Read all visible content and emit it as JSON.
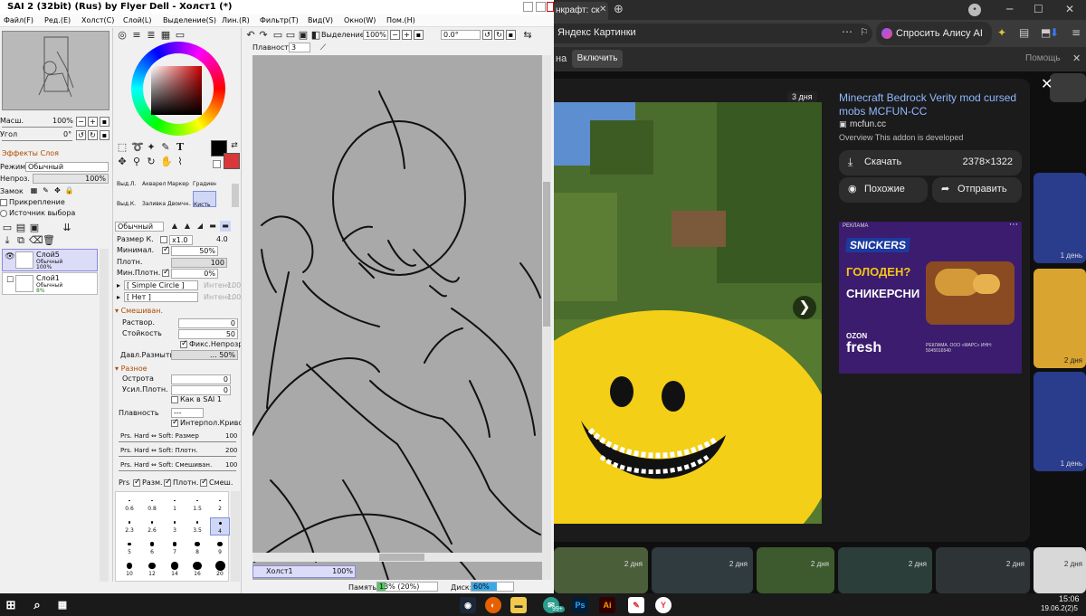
{
  "sai": {
    "title": "SAI 2 (32bit) (Rus) by Flyer Dell - Холст1 (*)",
    "menu": [
      "Файл(F)",
      "Ред.(E)",
      "Холст(C)",
      "Слой(L)",
      "Выделение(S)",
      "Лин.(R)",
      "Фильтр(T)",
      "Вид(V)",
      "Окно(W)",
      "Пом.(H)"
    ],
    "navigator": {
      "zoom_label": "Масш.",
      "zoom_value": "100%",
      "angle_label": "Угол",
      "angle_value": "0°"
    },
    "layer_props": {
      "effects_label": "Эффекты Слоя",
      "mode_label": "Режим",
      "mode_value": "Обычный",
      "opacity_label": "Непроз.",
      "opacity_value": "100%",
      "lock_label": "Замок",
      "clipping_label": "Прикрепление",
      "selection_source_label": "Источник выбора"
    },
    "layers": [
      {
        "name": "Слой5",
        "mode": "Обычный",
        "opacity": "100%",
        "selected": true
      },
      {
        "name": "Слой1",
        "mode": "Обычный",
        "opacity": "8%",
        "selected": false
      }
    ],
    "brush_tools": [
      {
        "label": "Выд.Л.",
        "active": false
      },
      {
        "label": "Акварель",
        "active": false
      },
      {
        "label": "Маркер",
        "active": false
      },
      {
        "label": "Градиент",
        "active": false
      },
      {
        "label": "Выд.К.",
        "active": false
      },
      {
        "label": "Заливка",
        "active": false
      },
      {
        "label": "Двоичн..",
        "active": false
      },
      {
        "label": "Кисть",
        "active": true
      }
    ],
    "brush": {
      "blend_mode": "Обычный",
      "size_label": "Размер К.",
      "size_mult": "x1.0",
      "size_value": "4.0",
      "min_label": "Минимал.",
      "min_value": "50%",
      "density_label": "Плотн.",
      "density_value": "100",
      "min_density_label": "Мин.Плотн.",
      "min_density_value": "0%",
      "shape_value": "[ Simple Circle ]",
      "shape_strength": "Интенс.",
      "shape_strength_value": "100",
      "texture_value": "[ Нет ]",
      "texture_strength": "Интенс.",
      "texture_strength_value": "100",
      "mix_section": "Смешиван.",
      "dilution_label": "Раствор.",
      "dilution_value": "0",
      "persistence_label": "Стойкость",
      "persistence_value": "50",
      "keep_opacity_label": "Фикс.Непрозр.",
      "blur_pressure_label": "Давл.Размытия",
      "blur_pressure_value": "... 50%",
      "misc_section": "Разное",
      "sharpness_label": "Острота",
      "sharpness_value": "0",
      "density_boost_label": "Усил.Плотн.",
      "density_boost_value": "0",
      "like_sai1_label": "Как в SAI 1",
      "smooth_label": "Плавность",
      "smooth_value": "---",
      "interp_curve_label": "Интерпол.Кривой",
      "prs_size_label": "Prs. Hard ⇔ Soft: Размер",
      "prs_size_value": "100",
      "prs_density_label": "Prs. Hard ⇔ Soft: Плотн.",
      "prs_density_value": "200",
      "prs_mix_label": "Prs. Hard ⇔ Soft: Смешиван.",
      "prs_mix_value": "100",
      "prs_label": "Prs",
      "prs_size_check": "Разм.",
      "prs_density_check": "Плотн.",
      "prs_mix_check": "Смеш."
    },
    "brush_sizes": [
      [
        "0.6",
        "0.8",
        "1",
        "1.5",
        "2"
      ],
      [
        "2.3",
        "2.6",
        "3",
        "3.5",
        "4"
      ],
      [
        "5",
        "6",
        "7",
        "8",
        "9"
      ],
      [
        "10",
        "12",
        "14",
        "16",
        "20"
      ]
    ],
    "canvas_toolbar": {
      "selection_label": "Выделение",
      "zoom_value": "100%",
      "angle_value": "0.0°",
      "smooth_label": "Плавность",
      "smooth_value": "3"
    },
    "canvas_tab": {
      "name": "Холст1",
      "zoom": "100%"
    },
    "status": {
      "memory_label": "Память:",
      "memory_value": "13% (20%)",
      "memory_fill": 0.13,
      "disk_label": "Диск:",
      "disk_value": "60%",
      "disk_fill": 0.6
    }
  },
  "browser": {
    "tab_title": "нкрафт: ск",
    "address_title": "Яндекс Картинки",
    "ask_alice": "Спросить Алису AI",
    "notif_text": "на",
    "notif_button": "Включить",
    "help": "Помощь",
    "preview": {
      "age_badge": "3 дня",
      "title": "Minecraft Bedrock Verity mod cursed mobs MCFUN-CC",
      "source": "mcfun.cc",
      "desc": "Overview This addon is developed",
      "download_label": "Скачать",
      "resolution": "2378×1322",
      "similar_label": "Похожие",
      "share_label": "Отправить"
    },
    "ad": {
      "tag": "РЕКЛАМА",
      "brand": "SNICKERS",
      "headline_1": "ГОЛОДЕН?",
      "headline_2": "СНИКЕРСНИ",
      "ozon": "OZON",
      "fresh": "fresh",
      "disclaimer": "РЕКЛАМА. ООО «МАРС» ИНН: 5045016540"
    },
    "side_labels": [
      "1 день",
      "2 дня",
      "1 день"
    ],
    "grid_labels": [
      "2 дня",
      "2 дня",
      "2 дня",
      "2 дня",
      "2 дня",
      "2 дня"
    ]
  },
  "taskbar": {
    "clock_time": "15:06",
    "clock_date": "19.06.2(2)5",
    "badge": "99+"
  },
  "colors": {
    "sai_accent": "#dcdcf8",
    "browser_bg": "#0f0f0f",
    "link": "#8fb8ff",
    "snickers_bg": "#3b1c6e",
    "primary_color": "#000000",
    "secondary_color": "#d9383a"
  }
}
